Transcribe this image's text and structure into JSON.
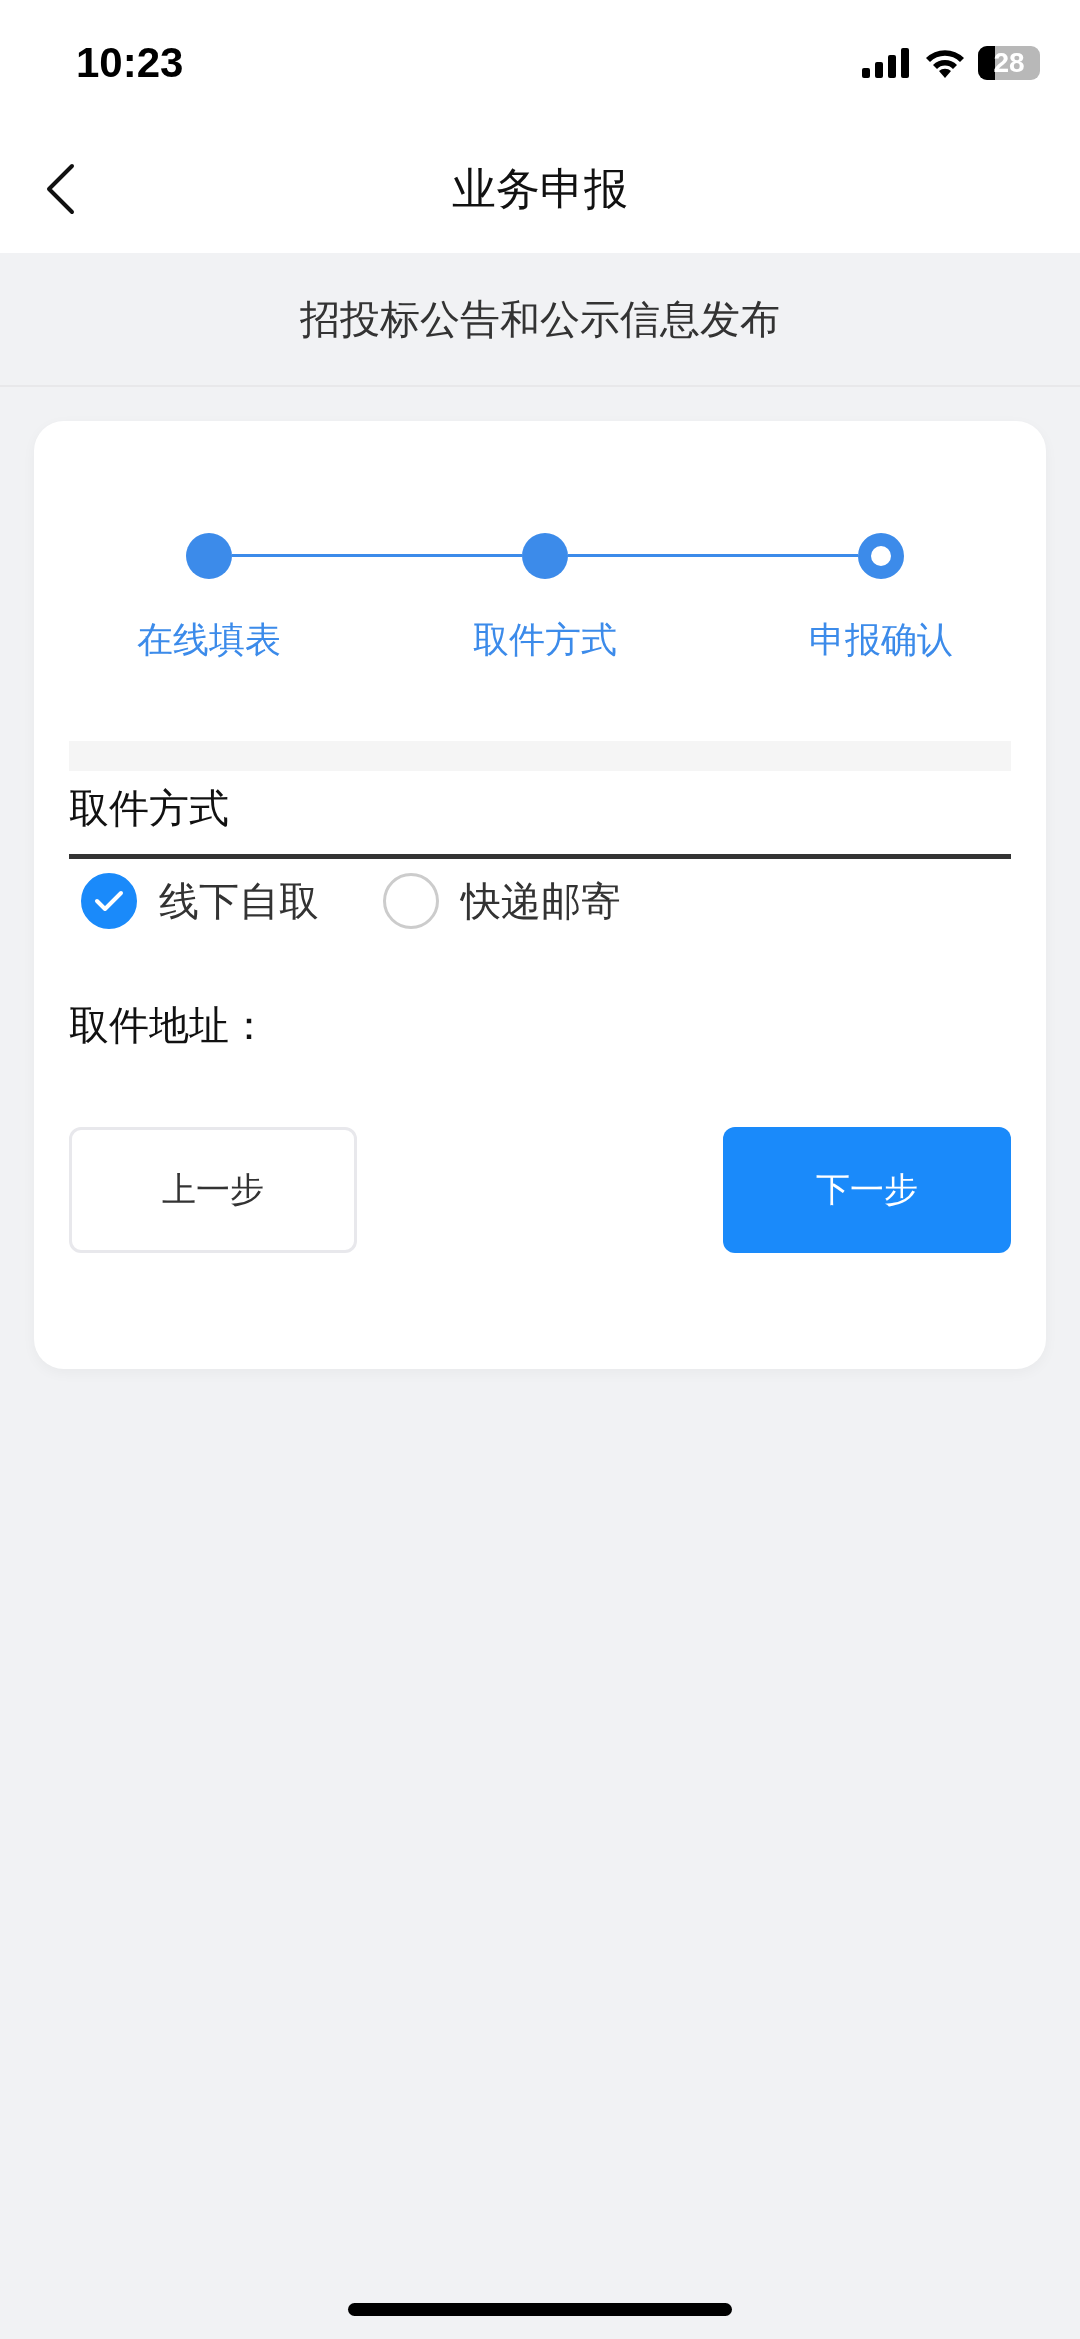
{
  "status_bar": {
    "time": "10:23",
    "battery": "28"
  },
  "nav": {
    "title": "业务申报"
  },
  "subtitle": "招投标公告和公示信息发布",
  "steps": [
    {
      "label": "在线填表",
      "current": false
    },
    {
      "label": "取件方式",
      "current": false
    },
    {
      "label": "申报确认",
      "current": true
    }
  ],
  "section": {
    "title": "取件方式"
  },
  "options": [
    {
      "label": "线下自取",
      "selected": true
    },
    {
      "label": "快递邮寄",
      "selected": false
    }
  ],
  "address_label": "取件地址：",
  "buttons": [
    {
      "label": "上一步",
      "kind": "secondary"
    },
    {
      "label": "下一步",
      "kind": "primary"
    }
  ]
}
